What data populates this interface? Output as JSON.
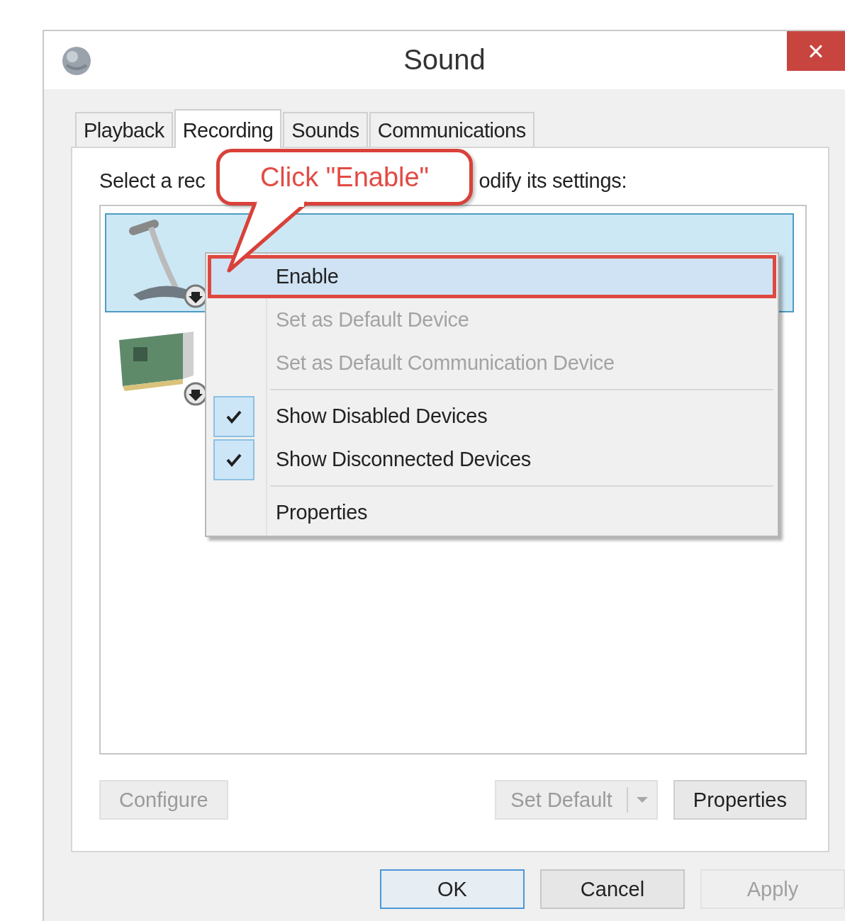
{
  "window": {
    "title": "Sound",
    "close": "×"
  },
  "tabs": [
    {
      "label": "Playback",
      "selected": false
    },
    {
      "label": "Recording",
      "selected": true
    },
    {
      "label": "Sounds",
      "selected": false
    },
    {
      "label": "Communications",
      "selected": false
    }
  ],
  "instruction": {
    "before": "Select a rec",
    "after": "odify its settings:"
  },
  "devices": [
    {
      "kind": "microphone",
      "selected": true
    },
    {
      "kind": "sound-card",
      "selected": false
    }
  ],
  "context_menu": [
    {
      "kind": "item",
      "label": "Enable",
      "disabled": false,
      "checked": false,
      "selected": true
    },
    {
      "kind": "item",
      "label": "Set as Default Device",
      "disabled": true,
      "checked": false,
      "selected": false
    },
    {
      "kind": "item",
      "label": "Set as Default Communication Device",
      "disabled": true,
      "checked": false,
      "selected": false
    },
    {
      "kind": "separator"
    },
    {
      "kind": "item",
      "label": "Show Disabled Devices",
      "disabled": false,
      "checked": true,
      "selected": false
    },
    {
      "kind": "item",
      "label": "Show Disconnected Devices",
      "disabled": false,
      "checked": true,
      "selected": false
    },
    {
      "kind": "separator"
    },
    {
      "kind": "item",
      "label": "Properties",
      "disabled": false,
      "checked": false,
      "selected": false
    }
  ],
  "annotation": {
    "text": "Click \"Enable\""
  },
  "panel_buttons": [
    {
      "kind": "button",
      "label": "Configure",
      "disabled": true
    },
    {
      "kind": "split",
      "label": "Set Default",
      "disabled": true
    },
    {
      "kind": "button",
      "label": "Properties",
      "disabled": false
    }
  ],
  "dialog_buttons": [
    {
      "label": "OK",
      "disabled": false,
      "default": true
    },
    {
      "label": "Cancel",
      "disabled": false,
      "default": false
    },
    {
      "label": "Apply",
      "disabled": true,
      "default": false
    }
  ]
}
